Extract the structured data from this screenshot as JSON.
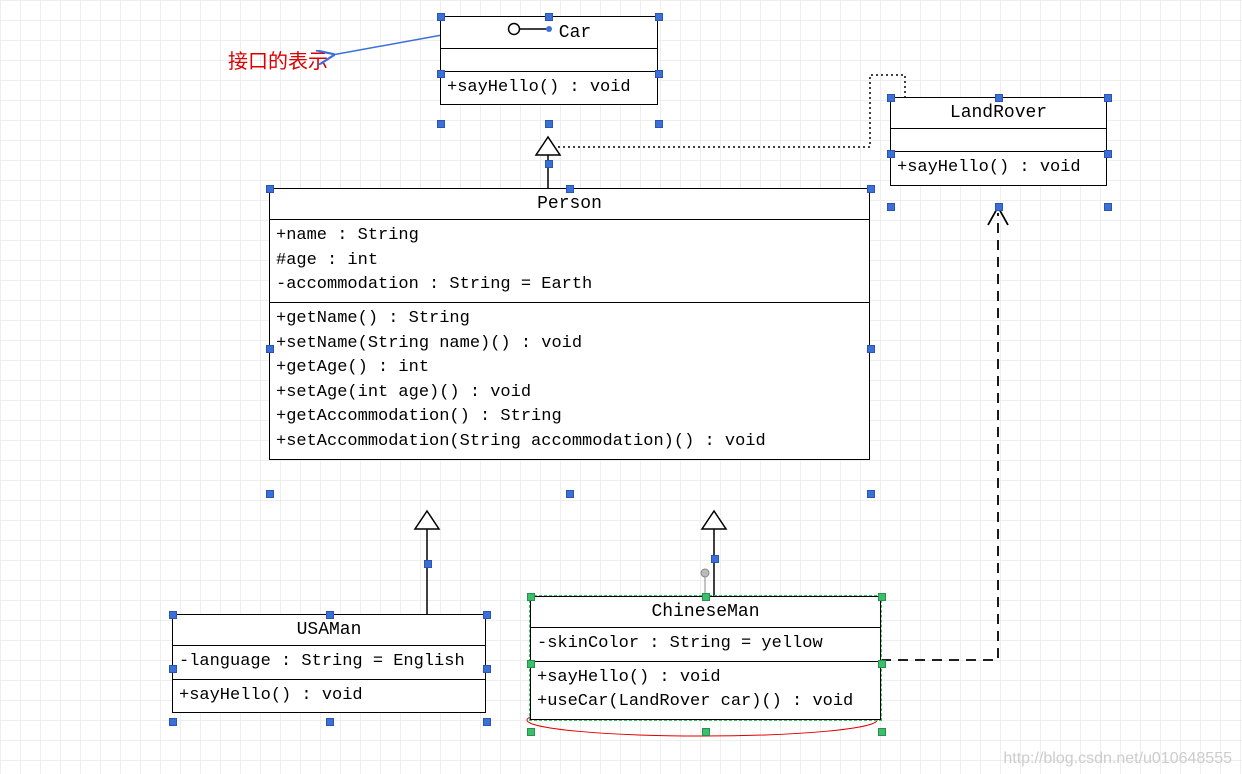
{
  "annotation": {
    "label": "接口的表示"
  },
  "car": {
    "name": "Car",
    "methods": [
      "+sayHello() : void"
    ]
  },
  "landrover": {
    "name": "LandRover",
    "methods": [
      "+sayHello() : void"
    ]
  },
  "person": {
    "name": "Person",
    "attrs": [
      "+name : String",
      "#age : int",
      "-accommodation : String = Earth"
    ],
    "methods": [
      "+getName() : String",
      "+setName(String name)() : void",
      "+getAge() : int",
      "+setAge(int age)() : void",
      "+getAccommodation() : String",
      "+setAccommodation(String accommodation)() : void"
    ]
  },
  "usaman": {
    "name": "USAMan",
    "attrs": [
      "-language : String = English"
    ],
    "methods": [
      "+sayHello() : void"
    ]
  },
  "chineseman": {
    "name": "ChineseMan",
    "attrs": [
      "-skinColor : String = yellow"
    ],
    "methods": [
      "+sayHello() : void",
      "+useCar(LandRover car)() : void"
    ]
  },
  "watermark": "http://blog.csdn.net/u010648555"
}
